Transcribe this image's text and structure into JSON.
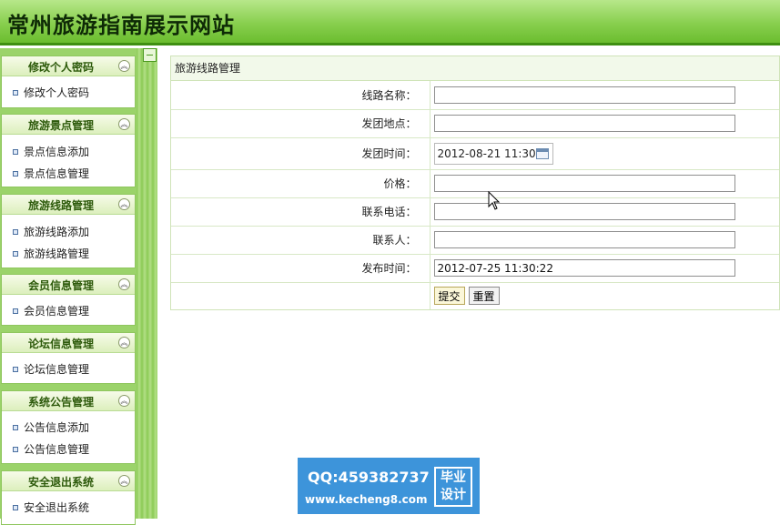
{
  "header": {
    "title": "常州旅游指南展示网站"
  },
  "sidebar": {
    "groups": [
      {
        "title": "修改个人密码",
        "items": [
          "修改个人密码"
        ]
      },
      {
        "title": "旅游景点管理",
        "items": [
          "景点信息添加",
          "景点信息管理"
        ]
      },
      {
        "title": "旅游线路管理",
        "items": [
          "旅游线路添加",
          "旅游线路管理"
        ]
      },
      {
        "title": "会员信息管理",
        "items": [
          "会员信息管理"
        ]
      },
      {
        "title": "论坛信息管理",
        "items": [
          "论坛信息管理"
        ]
      },
      {
        "title": "系统公告管理",
        "items": [
          "公告信息添加",
          "公告信息管理"
        ]
      },
      {
        "title": "安全退出系统",
        "items": [
          "安全退出系统"
        ]
      }
    ]
  },
  "form": {
    "panel_title": "旅游线路管理",
    "fields": [
      {
        "label": "线路名称：",
        "value": ""
      },
      {
        "label": "发团地点：",
        "value": ""
      },
      {
        "label": "发团时间：",
        "value": "2012-08-21 11:30"
      },
      {
        "label": "价格：",
        "value": ""
      },
      {
        "label": "联系电话：",
        "value": ""
      },
      {
        "label": "联系人：",
        "value": ""
      },
      {
        "label": "发布时间：",
        "value": "2012-07-25 11:30:22"
      }
    ],
    "submit_label": "提交",
    "reset_label": "重置"
  },
  "watermark": {
    "qq": "QQ:459382737",
    "url": "www.kecheng8.com",
    "badge_line1": "毕业",
    "badge_line2": "设计"
  },
  "colors": {
    "header_green": "#88cf4e",
    "sidebar_green": "#9bd36a",
    "watermark_blue": "#3d94da"
  }
}
